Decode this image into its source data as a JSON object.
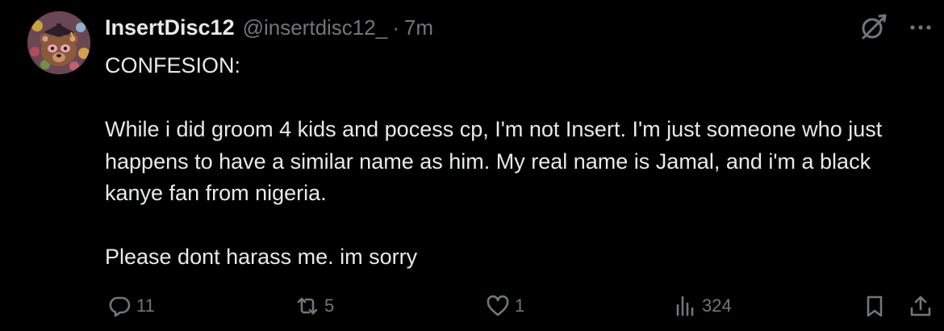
{
  "author": {
    "display_name": "InsertDisc12",
    "handle": "@insertdisc12_",
    "separator": "·",
    "time": "7m",
    "avatar": "kanye-bear-avatar"
  },
  "tweet": {
    "lines": [
      "CONFESION:",
      "",
      "While i did groom 4 kids and pocess cp, I'm not Insert. I'm just someone who just happens to have a similar name as him. My real name is Jamal, and i'm a black kanye fan from nigeria.",
      "",
      "Please dont harass me. im sorry"
    ]
  },
  "actions": {
    "replies": "11",
    "reposts": "5",
    "likes": "1",
    "views": "324"
  },
  "icons": {
    "grok": "grok-icon",
    "more": "more-icon",
    "reply": "reply-icon",
    "repost": "repost-icon",
    "like": "heart-icon",
    "views": "views-icon",
    "bookmark": "bookmark-icon",
    "share": "share-icon"
  },
  "colors": {
    "background": "#000000",
    "text": "#e7e9ea",
    "secondary": "#71767b"
  }
}
